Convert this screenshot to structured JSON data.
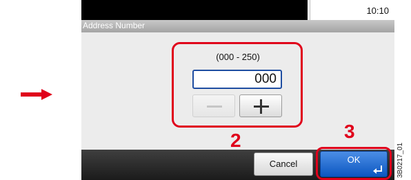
{
  "status": {
    "time": "10:10"
  },
  "title": "Address Number",
  "number_entry": {
    "range": "(000 - 250)",
    "value": "000"
  },
  "buttons": {
    "cancel": "Cancel",
    "ok": "OK"
  },
  "callouts": {
    "step_2": "2",
    "step_3": "3"
  },
  "figure_code": "3B0217_01",
  "icons": {
    "pointer": "right-arrow-icon",
    "minus": "minus-icon",
    "plus": "plus-icon",
    "enter": "enter-icon"
  },
  "colors": {
    "highlight": "#e0001b",
    "ok_button": "#1a64d0",
    "field_border": "#1e4da1"
  }
}
